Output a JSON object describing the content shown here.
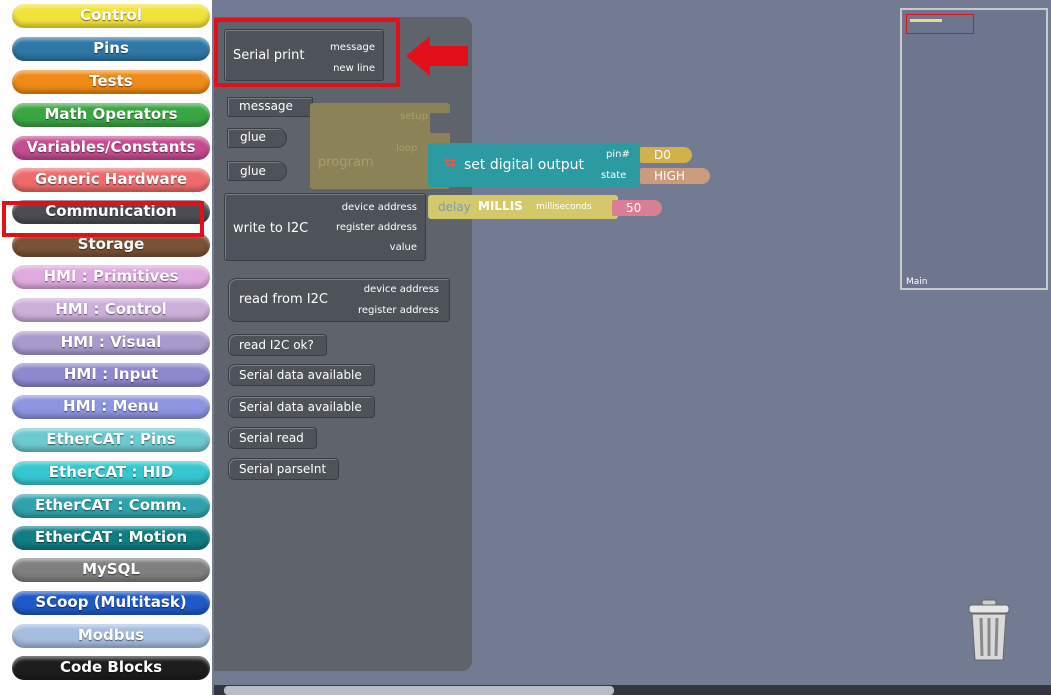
{
  "categories": [
    {
      "label": "Control",
      "color": "#f2e33a"
    },
    {
      "label": "Pins",
      "color": "#2f77a6"
    },
    {
      "label": "Tests",
      "color": "#ef8a16"
    },
    {
      "label": "Math Operators",
      "color": "#3aa641"
    },
    {
      "label": "Variables/Constants",
      "color": "#c84b91"
    },
    {
      "label": "Generic Hardware",
      "color": "#ef6b6b"
    },
    {
      "label": "Communication",
      "color": "#4a4d52"
    },
    {
      "label": "Storage",
      "color": "#7a5236"
    },
    {
      "label": "HMI : Primitives",
      "color": "#dfaadf"
    },
    {
      "label": "HMI : Control",
      "color": "#cbafd8"
    },
    {
      "label": "HMI : Visual",
      "color": "#a89acc"
    },
    {
      "label": "HMI : Input",
      "color": "#8e88cf"
    },
    {
      "label": "HMI : Menu",
      "color": "#8d94e0"
    },
    {
      "label": "EtherCAT : Pins",
      "color": "#6cc9cf"
    },
    {
      "label": "EtherCAT : HID",
      "color": "#34c7cf"
    },
    {
      "label": "EtherCAT : Comm.",
      "color": "#2fa3ad"
    },
    {
      "label": "EtherCAT : Motion",
      "color": "#0f7d84"
    },
    {
      "label": "MySQL",
      "color": "#7f7f7f"
    },
    {
      "label": "SCoop (Multitask)",
      "color": "#1e59c8"
    },
    {
      "label": "Modbus",
      "color": "#a6bde0"
    },
    {
      "label": "Code Blocks",
      "color": "#1d1d1d"
    }
  ],
  "flyout": {
    "serial_print": {
      "label": "Serial print",
      "message": "message",
      "new_line": "new line"
    },
    "message_label": "message",
    "glue1": "glue",
    "glue2": "glue",
    "write_i2c": {
      "label": "write to I2C",
      "device_address": "device address",
      "register_address": "register address",
      "value": "value"
    },
    "read_i2c": {
      "label": "read from I2C",
      "device_address": "device address",
      "register_address": "register address"
    },
    "read_i2c_ok": "read I2C ok?",
    "serial_data_available_1": "Serial data available",
    "serial_data_available_2": "Serial data available",
    "serial_read": "Serial read",
    "serial_parseint": "Serial parseInt"
  },
  "canvas": {
    "program": {
      "label": "program",
      "setup": "setup",
      "loop": "loop"
    },
    "set_digital_output": {
      "label": "set digital output",
      "pin_label": "pin#",
      "pin_value": "D0",
      "state_label": "state",
      "state_value": "HIGH"
    },
    "delay": {
      "label": "delay",
      "unit": "MILLIS",
      "ms_label": "milliseconds",
      "ms_value": "50"
    }
  },
  "minimap": {
    "label": "Main"
  },
  "colors": {
    "highlight": "#e3101b",
    "workspace": "#737b93",
    "flyout": "#5f636c",
    "block": "#4e5259"
  }
}
